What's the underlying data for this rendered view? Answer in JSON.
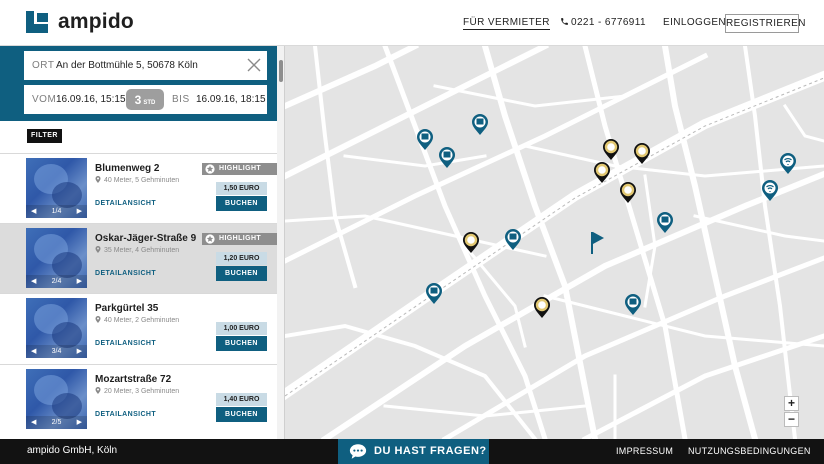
{
  "header": {
    "logo_text": "ampido",
    "nav": {
      "vermieter": "FÜR VERMIETER",
      "phone": "0221 - 6776911",
      "login": "EINLOGGEN",
      "register": "REGISTRIEREN"
    }
  },
  "search": {
    "ort_label": "ORT",
    "ort_value": "An der Bottmühle 5, 50678 Köln",
    "vom_label": "VOM",
    "vom_value": "16.09.16, 15:15",
    "duration_value": "3",
    "duration_unit": "STD",
    "bis_label": "BIS",
    "bis_value": "16.09.16, 18:15"
  },
  "filter_label": "FILTER",
  "listings": [
    {
      "title": "Blumenweg 2",
      "distance": "40 Meter, 5 Gehminuten",
      "detail": "DETAILANSICHT",
      "highlight": "HIGHLIGHT",
      "price": "1,50 EURO",
      "book": "BUCHEN",
      "pager": "1/4",
      "selected": false
    },
    {
      "title": "Oskar-Jäger-Straße 9",
      "distance": "35 Meter, 4 Gehminuten",
      "detail": "DETAILANSICHT",
      "highlight": "HIGHLIGHT",
      "price": "1,20 EURO",
      "book": "BUCHEN",
      "pager": "2/4",
      "selected": true
    },
    {
      "title": "Parkgürtel 35",
      "distance": "40 Meter, 2 Gehminuten",
      "detail": "DETAILANSICHT",
      "highlight": "",
      "price": "1,00 EURO",
      "book": "BUCHEN",
      "pager": "3/4",
      "selected": false
    },
    {
      "title": "Mozartstraße 72",
      "distance": "20 Meter, 3 Gehminuten",
      "detail": "DETAILANSICHT",
      "highlight": "",
      "price": "1,40 EURO",
      "book": "BUCHEN",
      "pager": "2/5",
      "selected": false
    }
  ],
  "map": {
    "zoom_in": "+",
    "zoom_out": "−",
    "pin_types": [
      "parking-pin",
      "highlight-pin",
      "charging-pin",
      "destination-flag"
    ]
  },
  "footer": {
    "company": "ampido GmbH, Köln",
    "help": "DU HAST FRAGEN?",
    "impressum": "IMPRESSUM",
    "terms": "NUTZUNGSBEDINGUNGEN"
  },
  "colors": {
    "brand": "#0f5f80",
    "highlight_badge": "#8e8e8e",
    "price_bg": "#c9dbe5",
    "footer": "#121212",
    "highlight_pin_ring": "#e2c872"
  }
}
